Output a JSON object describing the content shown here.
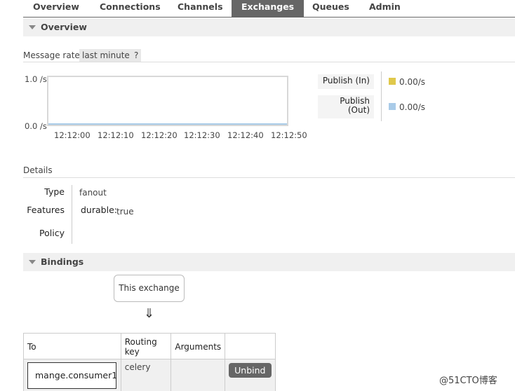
{
  "nav": {
    "tabs": [
      {
        "label": "Overview"
      },
      {
        "label": "Connections"
      },
      {
        "label": "Channels"
      },
      {
        "label": "Exchanges",
        "active": true
      },
      {
        "label": "Queues"
      },
      {
        "label": "Admin"
      }
    ]
  },
  "overview": {
    "title": "Overview",
    "message_rates_label": "Message rates",
    "range_option": "last minute",
    "help": "?",
    "chart_data": {
      "type": "line",
      "x": [
        "12:12:00",
        "12:12:10",
        "12:12:20",
        "12:12:30",
        "12:12:40",
        "12:12:50"
      ],
      "y_ticks": [
        "1.0 /s",
        "0.0 /s"
      ],
      "ylim": [
        0,
        1
      ],
      "series": [
        {
          "name": "Publish (In)",
          "values": [
            0,
            0,
            0,
            0,
            0,
            0
          ],
          "color": "#e0c84b"
        },
        {
          "name": "Publish (Out)",
          "values": [
            0,
            0,
            0,
            0,
            0,
            0
          ],
          "color": "#a9cbe8"
        }
      ]
    },
    "legend": [
      {
        "label": "Publish (In)",
        "value": "0.00/s",
        "color": "#e0c84b"
      },
      {
        "label_line1": "Publish",
        "label_line2": "(Out)",
        "value": "0.00/s",
        "color": "#a9cbe8"
      }
    ]
  },
  "details": {
    "title": "Details",
    "type_label": "Type",
    "type_value": "fanout",
    "features_label": "Features",
    "durable_label": "durable:",
    "durable_value": "true",
    "policy_label": "Policy"
  },
  "bindings": {
    "title": "Bindings",
    "this_exchange": "This exchange",
    "arrow": "⇓",
    "columns": [
      "To",
      "Routing key",
      "Arguments",
      ""
    ],
    "rows": [
      {
        "to": "mange.consumer1",
        "routing_key": "celery",
        "arguments": "",
        "action": "Unbind"
      }
    ]
  },
  "watermark": "@51CTO博客"
}
